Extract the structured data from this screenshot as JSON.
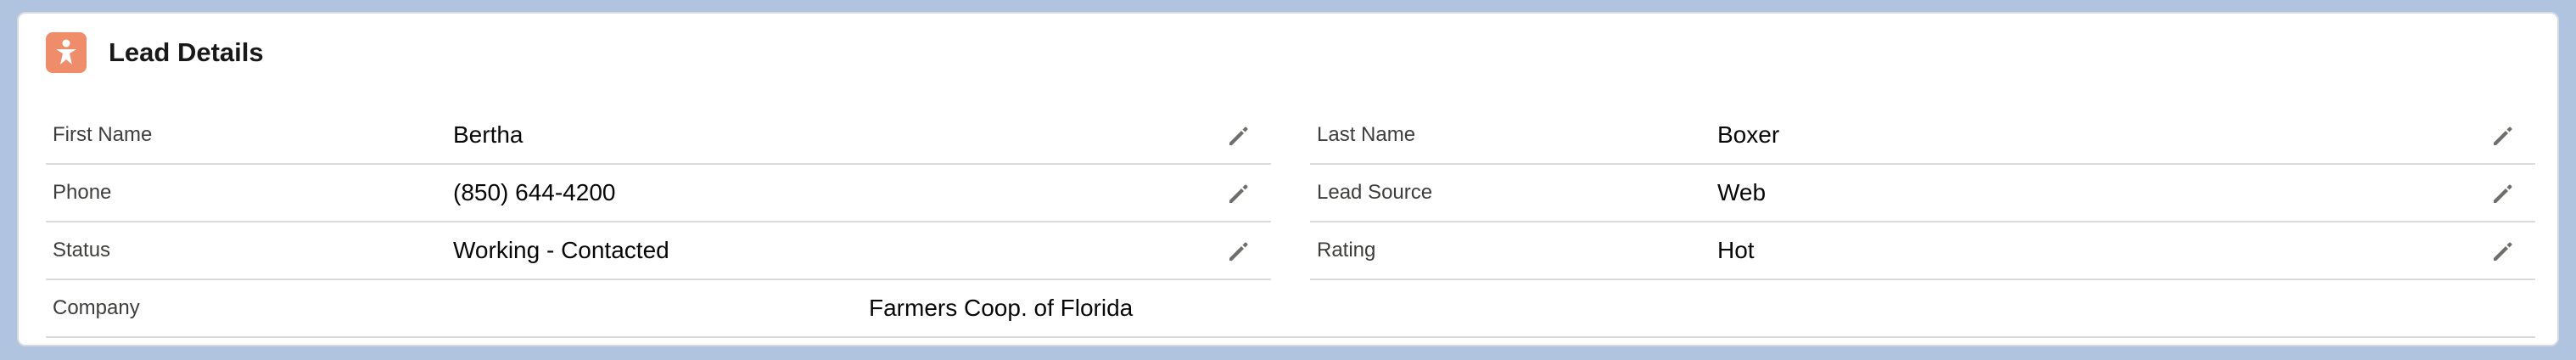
{
  "card": {
    "title": "Lead Details",
    "icon": "lead-icon",
    "icon_color": "#ef8c6a"
  },
  "fields": {
    "first_name": {
      "label": "First Name",
      "value": "Bertha"
    },
    "last_name": {
      "label": "Last Name",
      "value": "Boxer"
    },
    "phone": {
      "label": "Phone",
      "value": "(850) 644-4200"
    },
    "lead_source": {
      "label": "Lead Source",
      "value": "Web"
    },
    "status": {
      "label": "Status",
      "value": "Working - Contacted"
    },
    "rating": {
      "label": "Rating",
      "value": "Hot"
    },
    "company": {
      "label": "Company",
      "value": "Farmers Coop. of Florida"
    }
  },
  "icons": {
    "edit": "pencil-icon"
  }
}
